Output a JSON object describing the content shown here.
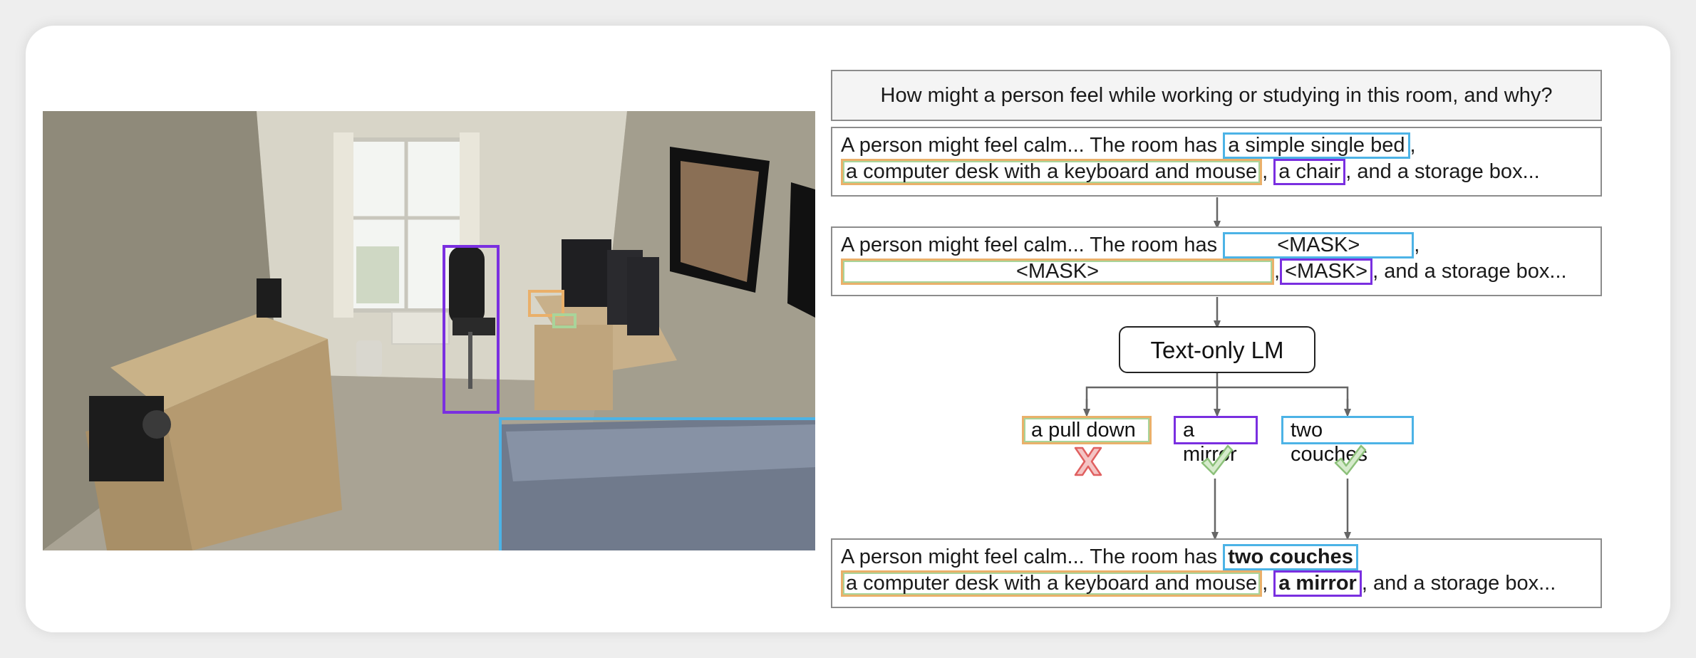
{
  "question": "How might a person feel while working or studying in this room, and why?",
  "original": {
    "prefix": "A person might feel calm... The room has",
    "span_bed": "a simple single bed",
    "comma1": ",",
    "span_desk": "a computer desk with a keyboard and mouse",
    "comma2": ",",
    "span_chair": "a chair",
    "suffix": ", and a storage box..."
  },
  "masked": {
    "prefix": "A person might feel calm... The room has",
    "mask1": "<MASK>",
    "comma1": ",",
    "mask2": "<MASK>",
    "comma2": ",",
    "mask3": "<MASK>",
    "suffix": ", and a storage box..."
  },
  "model_label": "Text-only LM",
  "candidates": [
    {
      "text": "a pull down",
      "verdict": "wrong"
    },
    {
      "text": "a mirror",
      "verdict": "correct"
    },
    {
      "text": "two couches",
      "verdict": "correct"
    }
  ],
  "result": {
    "prefix": "A person might feel calm... The room has",
    "span_couches": "two couches",
    "span_desk": "a computer desk with a keyboard and mouse",
    "comma2": ",",
    "span_mirror": "a mirror",
    "suffix": ", and a storage box..."
  },
  "colors": {
    "blue": "#4cb3e6",
    "purple": "#7a2fe0",
    "orange": "#eab06a",
    "green": "#a9d49a",
    "cross": "#e06060",
    "check": "#8cc07a"
  },
  "icons": [
    "cross-icon",
    "check-icon",
    "arrow-down-icon"
  ]
}
